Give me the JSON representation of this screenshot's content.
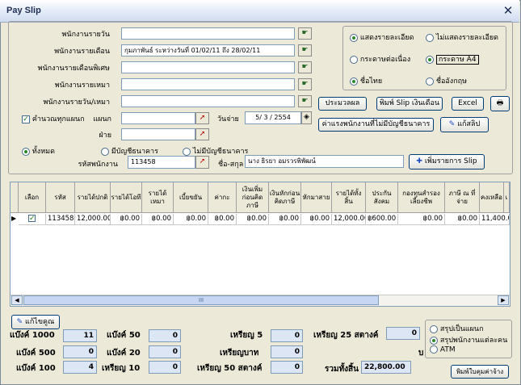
{
  "window": {
    "title": "Pay Slip"
  },
  "form": {
    "rows": [
      {
        "label": "พนักงานรายวัน",
        "value": ""
      },
      {
        "label": "พนักงานรายเดือน",
        "value": "กุมภาพันธ์ ระหว่างวันที่ 01/02/11 ถึง 28/02/11"
      },
      {
        "label": "พนักงานรายเดือนพิเศษ",
        "value": ""
      },
      {
        "label": "พนักงานรายเหมา",
        "value": ""
      },
      {
        "label": "พนักงานรายวัน/เหมา",
        "value": ""
      }
    ],
    "calc_all_label": "คำนวณทุกแผนก",
    "dept_label": "แผนก",
    "section_label": "ฝ่าย",
    "payday_label": "วันจ่าย",
    "payday_value": "5/ 3 / 2554",
    "filter_all": "ทั้งหมด",
    "filter_has_account": "มีบัญชีธนาคาร",
    "filter_no_account": "ไม่มีบัญชีธนาคาร",
    "emp_code_label": "รหัสพนักงาน",
    "emp_code_value": "113458",
    "name_label": "ชื่อ-สกุล",
    "name_value": "นาง ธิรยา อมรวรพิพัฒน์"
  },
  "options": {
    "show_detail": "แสดงรายละเอียด",
    "no_detail": "ไม่แสดงรายละเอียด",
    "paper_continuous": "กระดาษต่อเนื่อง",
    "paper_a4": "กระดาษ A4",
    "thai_name": "ชื่อไทย",
    "english_name": "ชื่ออังกฤษ"
  },
  "buttons": {
    "process": "ประมวลผล",
    "print_slip": "พิมพ์ Slip เงินเดือน",
    "excel": "Excel",
    "wage_no_account": "ค่าแรงพนักงานที่ไม่มีบัญชีธนาคาร",
    "edit_slip": "แก้สลิป",
    "add_slip": "เพิ่มรายการ Slip",
    "edit_coupon": "แก้ไขคูณ",
    "print_wage_sheet": "พิมพ์ใบคุมค่าจ้าง"
  },
  "table": {
    "headers": [
      "เลือก",
      "รหัส",
      "รายได้ปกติ",
      "รายได้โอที",
      "รายได้เหมา",
      "เบี้ยขยัน",
      "ค่ากะ",
      "เงินเพิ่มก่อนคิดภาษี",
      "เงินหักก่อนคิดภาษี",
      "หักมาสาย",
      "รายได้ทั้งสิ้น",
      "ประกันสังคม",
      "กองทุนสำรองเลี้ยงชีพ",
      "ภาษี ณ ที่จ่าย",
      "คงเหลือ",
      "เ"
    ],
    "rows": [
      [
        "",
        "113458",
        "12,000.00",
        "฿0.00",
        "฿0.00",
        "฿0.00",
        "฿0.00",
        "฿0.00",
        "฿0.00",
        "฿0.00",
        "12,000.00",
        "฿600.00",
        "฿0.00",
        "฿0.00",
        "11,400.00",
        ""
      ]
    ],
    "scroll_label": "III"
  },
  "summary": {
    "bank_1000_label": "แบ๊งค์ 1000",
    "bank_1000": "11",
    "bank_500_label": "แบ๊งค์ 500",
    "bank_500": "0",
    "bank_100_label": "แบ๊งค์ 100",
    "bank_100": "4",
    "bank_50_label": "แบ๊งค์ 50",
    "bank_50": "0",
    "bank_20_label": "แบ๊งค์ 20",
    "bank_20": "0",
    "coin_10_label": "เหรียญ 10",
    "coin_10": "0",
    "coin_5_label": "เหรียญ 5",
    "coin_5": "0",
    "coin_baht_label": "เหรียญบาท",
    "coin_baht": "0",
    "coin_50s_label": "เหรียญ 50 สตางค์",
    "coin_50s": "0",
    "coin_25s_label": "เหรียญ 25 สตางค์",
    "coin_25s": "0",
    "total_label": "รวมทั้งสิ้น",
    "total": "22,800.00",
    "b_label": "บ"
  },
  "summary_options": {
    "by_dept": "สรุปเป็นแผนก",
    "by_person": "สรุปพนักงานแต่ละคน",
    "atm": "ATM"
  }
}
